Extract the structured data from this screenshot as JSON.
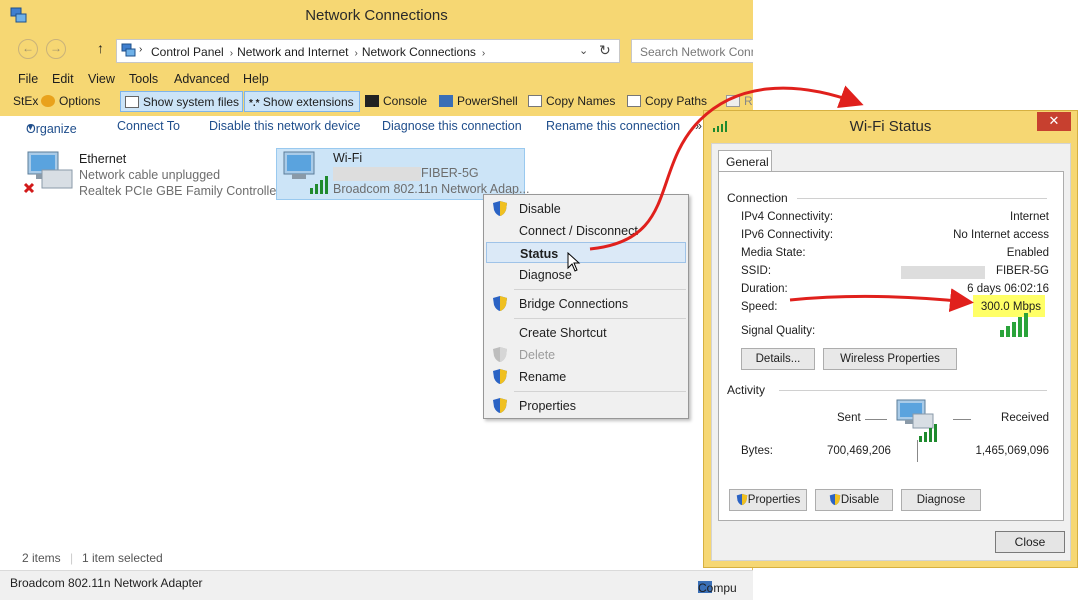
{
  "explorer": {
    "title": "Network Connections",
    "address": {
      "crumbs": [
        "Control Panel",
        "Network and Internet",
        "Network Connections"
      ],
      "search_placeholder": "Search Network Conn"
    },
    "menu": [
      "File",
      "Edit",
      "View",
      "Tools",
      "Advanced",
      "Help"
    ],
    "stex_toolbar": {
      "stex": "StEx",
      "options": "Options",
      "show_system_files": "Show system files",
      "show_extensions": "Show extensions",
      "console": "Console",
      "powershell": "PowerShell",
      "copy_names": "Copy Names",
      "copy_paths": "Copy Paths",
      "last": "R"
    },
    "commands": [
      "Organize",
      "Connect To",
      "Disable this network device",
      "Diagnose this connection",
      "Rename this connection"
    ],
    "items": [
      {
        "name": "Ethernet",
        "status": "Network cable unplugged",
        "device": "Realtek PCIe GBE Family Controller"
      },
      {
        "name": "Wi-Fi",
        "ssid_suffix": "FIBER-5G",
        "device": "Broadcom 802.11n Network Adap..."
      }
    ],
    "status_count": "2 items",
    "status_selected": "1 item selected",
    "status_device": "Broadcom 802.11n Network Adapter",
    "status_computer": "Compu"
  },
  "context_menu": {
    "items": [
      {
        "label": "Disable",
        "shield": true
      },
      {
        "label": "Connect / Disconnect",
        "shield": false
      },
      {
        "label": "Status",
        "shield": false,
        "bold": true,
        "highlighted": true
      },
      {
        "label": "Diagnose",
        "shield": false
      },
      {
        "label": "Bridge Connections",
        "shield": true
      },
      {
        "label": "Create Shortcut",
        "shield": false
      },
      {
        "label": "Delete",
        "shield": true,
        "disabled": true
      },
      {
        "label": "Rename",
        "shield": true
      },
      {
        "label": "Properties",
        "shield": true
      }
    ]
  },
  "wifi_status": {
    "title": "Wi-Fi Status",
    "tab": "General",
    "connection_heading": "Connection",
    "rows": [
      {
        "label": "IPv4 Connectivity:",
        "value": "Internet"
      },
      {
        "label": "IPv6 Connectivity:",
        "value": "No Internet access"
      },
      {
        "label": "Media State:",
        "value": "Enabled"
      },
      {
        "label": "SSID:",
        "value": "FIBER-5G"
      },
      {
        "label": "Duration:",
        "value": "6 days 06:02:16"
      },
      {
        "label": "Speed:",
        "value": "300.0 Mbps"
      },
      {
        "label": "Signal Quality:",
        "value": ""
      }
    ],
    "details_button": "Details...",
    "wireless_properties_button": "Wireless Properties",
    "activity_heading": "Activity",
    "sent_label": "Sent",
    "received_label": "Received",
    "bytes_label": "Bytes:",
    "bytes_sent": "700,469,206",
    "bytes_received": "1,465,069,096",
    "properties_button": "Properties",
    "disable_button": "Disable",
    "diagnose_button": "Diagnose",
    "close_button": "Close"
  },
  "colors": {
    "titlebar": "#f6d773",
    "link_blue": "#1f4e8c",
    "annotation_red": "#e0201c",
    "highlight_yellow": "#ffff66"
  }
}
